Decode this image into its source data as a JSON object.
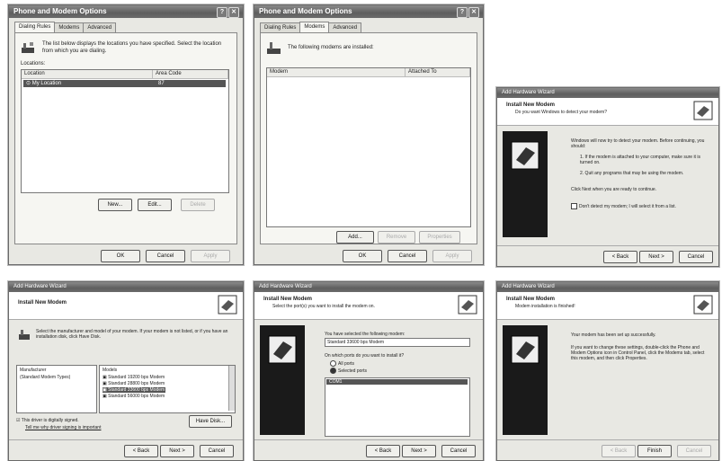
{
  "w1": {
    "title": "Phone and Modem Options",
    "tabs": [
      "Dialing Rules",
      "Modems",
      "Advanced"
    ],
    "desc": "The list below displays the locations you have specified. Select the location from which you are dialing.",
    "locations_label": "Locations:",
    "col_location": "Location",
    "col_area": "Area Code",
    "row_location": "My Location",
    "row_area": "87",
    "btn_new": "New...",
    "btn_edit": "Edit...",
    "btn_delete": "Delete",
    "btn_ok": "OK",
    "btn_cancel": "Cancel",
    "btn_apply": "Apply"
  },
  "w2": {
    "title": "Phone and Modem Options",
    "tabs": [
      "Dialing Rules",
      "Modems",
      "Advanced"
    ],
    "desc": "The following modems are installed:",
    "col_modem": "Modem",
    "col_attached": "Attached To",
    "btn_add": "Add...",
    "btn_remove": "Remove",
    "btn_properties": "Properties",
    "btn_ok": "OK",
    "btn_cancel": "Cancel",
    "btn_apply": "Apply"
  },
  "w3": {
    "title": "Add Hardware Wizard",
    "header_title": "Install New Modem",
    "header_sub": "Do you want Windows to detect your modem?",
    "intro": "Windows will now try to detect your modem. Before continuing, you should:",
    "step1": "1. If the modem is attached to your computer, make sure it is turned on.",
    "step2": "2. Quit any programs that may be using the modem.",
    "next_hint": "Click Next when you are ready to continue.",
    "checkbox": "Don't detect my modem; I will select it from a list.",
    "btn_back": "< Back",
    "btn_next": "Next >",
    "btn_cancel": "Cancel"
  },
  "w4": {
    "title": "Add Hardware Wizard",
    "header_title": "Install New Modem",
    "desc": "Select the manufacturer and model of your modem. If your modem is not listed, or if you have an installation disk, click Have Disk.",
    "mfr_label": "Manufacturer",
    "mfr_item": "(Standard Modem Types)",
    "model_label": "Models",
    "models": [
      "Standard 19200 bps Modem",
      "Standard 28800 bps Modem",
      "Standard 33600 bps Modem",
      "Standard 56000 bps Modem"
    ],
    "signed": "This driver is digitally signed.",
    "signing_link": "Tell me why driver signing is important",
    "btn_have_disk": "Have Disk...",
    "btn_back": "< Back",
    "btn_next": "Next >",
    "btn_cancel": "Cancel"
  },
  "w5": {
    "title": "Add Hardware Wizard",
    "header_title": "Install New Modem",
    "header_sub": "Select the port(s) you want to install the modem on.",
    "selected_label": "You have selected the following modem:",
    "selected_modem": "Standard 33600 bps Modem",
    "ports_q": "On which ports do you want to install it?",
    "opt_all": "All ports",
    "opt_selected": "Selected ports",
    "port_item": "COM1",
    "btn_back": "< Back",
    "btn_next": "Next >",
    "btn_cancel": "Cancel"
  },
  "w6": {
    "title": "Add Hardware Wizard",
    "header_title": "Install New Modem",
    "header_sub": "Modem installation is finished!",
    "msg1": "Your modem has been set up successfully.",
    "msg2": "If you want to change these settings, double-click the Phone and Modem Options icon in Control Panel, click the Modems tab, select this modem, and then click Properties.",
    "btn_back": "< Back",
    "btn_finish": "Finish",
    "btn_cancel": "Cancel"
  }
}
